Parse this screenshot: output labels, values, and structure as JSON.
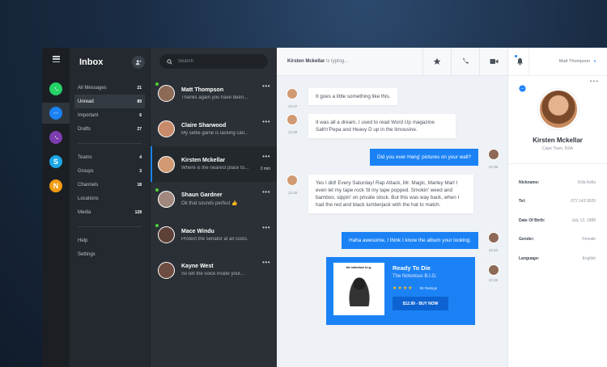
{
  "folders": {
    "title": "Inbox",
    "items": [
      {
        "label": "All Messages",
        "count": "21"
      },
      {
        "label": "Unread",
        "count": "89"
      },
      {
        "label": "Important",
        "count": "6"
      },
      {
        "label": "Drafts",
        "count": "27"
      }
    ],
    "groups": [
      {
        "label": "Teams",
        "count": "4"
      },
      {
        "label": "Groups",
        "count": "3"
      },
      {
        "label": "Channels",
        "count": "18"
      },
      {
        "label": "Locations",
        "count": ""
      },
      {
        "label": "Media",
        "count": "128"
      }
    ],
    "footer": [
      {
        "label": "Help"
      },
      {
        "label": "Settings"
      }
    ]
  },
  "search": {
    "placeholder": "Search"
  },
  "conversations": [
    {
      "name": "Matt Thompson",
      "preview": "Thanks again you have been...",
      "time": ""
    },
    {
      "name": "Claire Sharwood",
      "preview": "My selfie game is lacking can...",
      "time": ""
    },
    {
      "name": "Kirsten Mckellar",
      "preview": "Where is the nearest place to...",
      "time": "2 min"
    },
    {
      "name": "Shaun Gardner",
      "preview": "Ok that sounds perfect 👍",
      "time": ""
    },
    {
      "name": "Mace Windu",
      "preview": "Protect the senator at all costs.",
      "time": ""
    },
    {
      "name": "Kayne West",
      "preview": "So tell the voice inside your...",
      "time": ""
    }
  ],
  "chat": {
    "typing_name": "Kirsten Mckellar",
    "typing_suffix": "is typing...",
    "messages": [
      {
        "text": "It goes a little something like this.",
        "time": "12:47"
      },
      {
        "text": "It was all a dream, I used to read Word Up magazine Salt'n'Pepa and Heavy D up in the limousine.",
        "time": "12:39"
      },
      {
        "text": "Did you ever Hang' pictures on your wall?",
        "time": "12:39"
      },
      {
        "text": "Yes I did! Every Saturday! Rap Attack, Mr. Magic, Marley Marl I even let my tape rock 'til my tape popped. Smokin' weed and bamboo, sippin' on private stock.  But this was way back, when I had the red and black lumberjack with the hat to match.",
        "time": "12:40"
      },
      {
        "text": "Haha awesome,  I think I know the album your looking.",
        "time": "12:43"
      }
    ],
    "card": {
      "cover_text": "the notorious b.i.g.",
      "title": "Ready To Die",
      "artist": "The Notorious B.I.G.",
      "stars": "★★★★",
      "ratings": "95 Ratings",
      "buy_label": "$12.99  -  BUY NOW",
      "time": "12:45"
    }
  },
  "profile": {
    "user_menu": "Matt Thompson",
    "name": "Kirsten Mckellar",
    "location": "Cape Town, RSA",
    "fields": [
      {
        "key": "Nickname:",
        "value": "Killa Kella"
      },
      {
        "key": "Tel:",
        "value": "072 143 9920"
      },
      {
        "key": "Date Of Birth:",
        "value": "July 12, 1988"
      },
      {
        "key": "Gender:",
        "value": "Female"
      },
      {
        "key": "Language:",
        "value": "English"
      }
    ]
  },
  "colors": {
    "accent": "#1b82f5",
    "online": "#4cd137",
    "star": "#ffc21a"
  },
  "icons": [
    "menu-icon",
    "whatsapp-icon",
    "messenger-icon",
    "viber-icon",
    "skype-icon",
    "n-app-icon",
    "new-message-icon",
    "search-icon",
    "star-icon",
    "phone-icon",
    "video-icon",
    "bell-icon",
    "more-dots-icon"
  ]
}
